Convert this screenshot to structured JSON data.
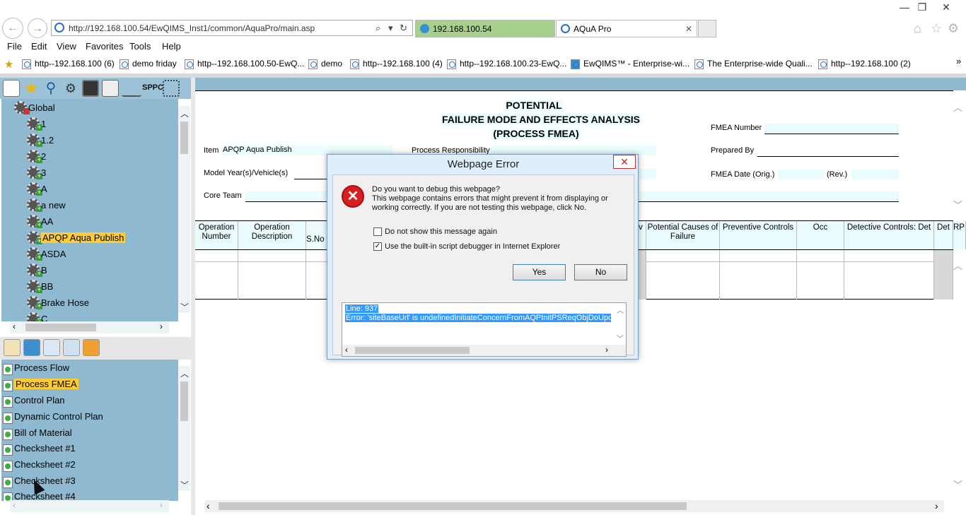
{
  "window": {
    "minimize": "—",
    "restore": "❐",
    "close": "✕"
  },
  "browser": {
    "address": "http://192.168.100.54/EwQIMS_Inst1/common/AquaPro/main.asp",
    "search_icon": "⌕",
    "dropdown_icon": "▾",
    "refresh_icon": "↻",
    "tabs": [
      {
        "label": "192.168.100.54"
      },
      {
        "label": "AQuA Pro",
        "close": "✕"
      }
    ],
    "home_icon": "⌂",
    "star_icon": "☆",
    "gear_icon": "⚙"
  },
  "menu": {
    "items": [
      "File",
      "Edit",
      "View",
      "Favorites",
      "Tools",
      "Help"
    ]
  },
  "favorites": {
    "items": [
      "http--192.168.100 (6)",
      "demo friday",
      "http--192.168.100.50-EwQ...",
      "demo",
      "http--192.168.100 (4)",
      "http--192.168.100.23-EwQ...",
      "EwQIMS™ - Enterprise-wi...",
      "The Enterprise-wide Quali...",
      "http--192.168.100 (2)"
    ],
    "more": "»"
  },
  "left_toolbar": {
    "sppc_label": "SPPC"
  },
  "tree": {
    "items": [
      {
        "label": "Global",
        "highlight": false
      },
      {
        "label": "1",
        "highlight": false
      },
      {
        "label": "1.2",
        "highlight": false
      },
      {
        "label": "2",
        "highlight": false
      },
      {
        "label": "3",
        "highlight": false
      },
      {
        "label": "A",
        "highlight": false
      },
      {
        "label": "a new",
        "highlight": false
      },
      {
        "label": "AA",
        "highlight": false
      },
      {
        "label": "APQP Aqua Publish",
        "highlight": true
      },
      {
        "label": "ASDA",
        "highlight": false
      },
      {
        "label": "B",
        "highlight": false
      },
      {
        "label": "BB",
        "highlight": false
      },
      {
        "label": "Brake Hose",
        "highlight": false
      },
      {
        "label": "C",
        "highlight": false
      }
    ]
  },
  "documents": {
    "items": [
      {
        "label": "Process Flow",
        "highlight": false
      },
      {
        "label": "Process FMEA",
        "highlight": true
      },
      {
        "label": "Control Plan",
        "highlight": false
      },
      {
        "label": "Dynamic Control Plan",
        "highlight": false
      },
      {
        "label": "Bill of Material",
        "highlight": false
      },
      {
        "label": "Checksheet #1",
        "highlight": false
      },
      {
        "label": "Checksheet #2",
        "highlight": false
      },
      {
        "label": "Checksheet #3",
        "highlight": false
      },
      {
        "label": "Checksheet #4",
        "highlight": false
      }
    ]
  },
  "form": {
    "title_line1": "POTENTIAL",
    "title_line2": "FAILURE MODE AND EFFECTS ANALYSIS",
    "title_line3": "(PROCESS FMEA)",
    "fmea_number_label": "FMEA Number",
    "item_label": "Item",
    "item_value": "APQP Aqua Publish",
    "process_responsibility_label": "Process Responsibility",
    "prepared_by_label": "Prepared By",
    "model_year_label": "Model Year(s)/Vehicle(s)",
    "fmea_date_label": "FMEA Date (Orig.)",
    "rev_label": "(Rev.)",
    "core_team_label": "Core Team",
    "columns": {
      "op_number": "Operation Number",
      "op_description": "Operation Description",
      "s_no": "S.No",
      "sev": "v",
      "causes": "Potential Causes of Failure",
      "preventive": "Preventive Controls",
      "occ": "Occ",
      "detective": "Detective Controls: Det",
      "det": "Det",
      "rpn": "RP"
    }
  },
  "dialog": {
    "title": "Webpage Error",
    "close": "✕",
    "icon": "✕",
    "question": "Do you want to debug this webpage?",
    "message_line1": "This webpage contains errors that might prevent it from displaying or",
    "message_line2": "working correctly. If you are not testing this webpage, click No.",
    "checkbox1_label": "Do not show this message again",
    "checkbox1_checked": false,
    "checkbox2_label": "Use the built-in script debugger in Internet Explorer",
    "checkbox2_checked": true,
    "checkmark": "✓",
    "yes_label": "Yes",
    "no_label": "No",
    "details_line1": "Line: 937",
    "details_line2": "Error: 'siteBaseUrl' is undefinedInitiateConcernFromAQPInitPSReqObjDoUpdate"
  }
}
